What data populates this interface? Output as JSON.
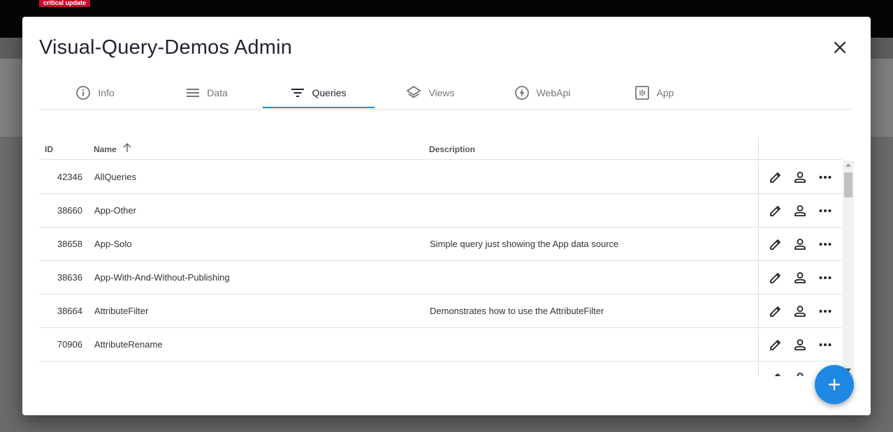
{
  "background": {
    "badge": "critical update"
  },
  "dialog": {
    "title": "Visual-Query-Demos Admin",
    "close_icon": "close-icon"
  },
  "tabs": [
    {
      "label": "Info",
      "icon": "info-icon",
      "active": false
    },
    {
      "label": "Data",
      "icon": "menu-lines-icon",
      "active": false
    },
    {
      "label": "Queries",
      "icon": "filter-icon",
      "active": true
    },
    {
      "label": "Views",
      "icon": "layers-icon",
      "active": false
    },
    {
      "label": "WebApi",
      "icon": "bolt-icon",
      "active": false
    },
    {
      "label": "App",
      "icon": "settings-box-icon",
      "active": false
    }
  ],
  "table": {
    "columns": {
      "id": "ID",
      "name": "Name",
      "description": "Description"
    },
    "sort_icon": "arrow-up-icon",
    "rows": [
      {
        "id": "42346",
        "name": "AllQueries",
        "description": ""
      },
      {
        "id": "38660",
        "name": "App-Other",
        "description": ""
      },
      {
        "id": "38658",
        "name": "App-Solo",
        "description": "Simple query just showing the App data source"
      },
      {
        "id": "38636",
        "name": "App-With-And-Without-Publishing",
        "description": ""
      },
      {
        "id": "38664",
        "name": "AttributeFilter",
        "description": "Demonstrates how to use the AttributeFilter"
      },
      {
        "id": "70906",
        "name": "AttributeRename",
        "description": ""
      },
      {
        "id": "",
        "name": "",
        "description": ""
      }
    ],
    "row_actions": [
      "edit-icon",
      "person-icon",
      "more-horizontal-icon"
    ]
  },
  "fab_icon": "plus-icon",
  "colors": {
    "accent": "#1e88e5",
    "badge": "#c8102e"
  }
}
